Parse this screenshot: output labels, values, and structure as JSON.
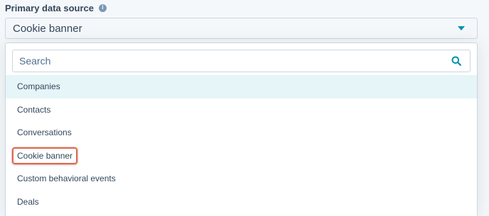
{
  "field": {
    "label": "Primary data source",
    "info_icon": "info-icon",
    "selected_value": "Cookie banner",
    "toggle_icon": "caret-down-icon"
  },
  "dropdown": {
    "search": {
      "placeholder": "Search",
      "value": "",
      "icon": "search-icon"
    },
    "options": [
      {
        "label": "Companies",
        "state": "hovered"
      },
      {
        "label": "Contacts",
        "state": "normal"
      },
      {
        "label": "Conversations",
        "state": "normal"
      },
      {
        "label": "Cookie banner",
        "state": "highlighted"
      },
      {
        "label": "Custom behavioral events",
        "state": "normal"
      },
      {
        "label": "Deals",
        "state": "normal"
      }
    ]
  },
  "colors": {
    "accent": "#0091ae",
    "text": "#33475b",
    "hover_bg": "#e5f5f8",
    "highlight_border": "#e0684f",
    "border": "#cbd6e2"
  }
}
